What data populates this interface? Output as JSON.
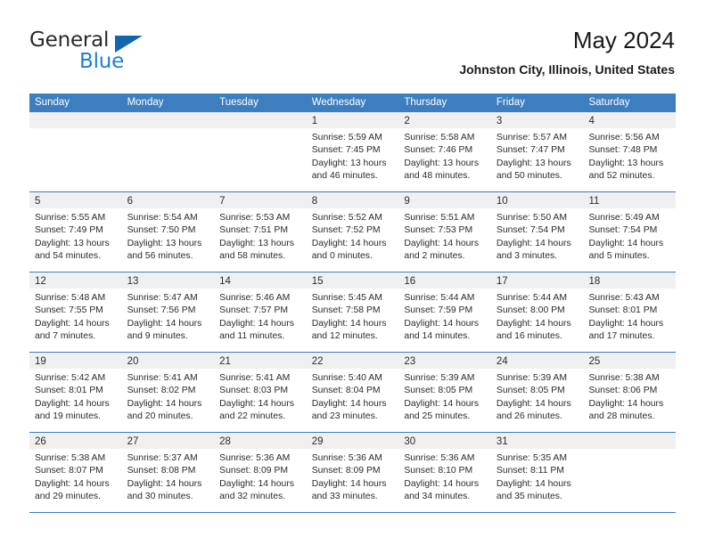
{
  "brand": {
    "name_top": "General",
    "name_bottom": "Blue",
    "flag_icon": "triangle-flag-icon",
    "color_top": "#2a2a2a",
    "color_bottom": "#1c7fd0",
    "flag_color": "#1266ad"
  },
  "header": {
    "title": "May 2024",
    "location": "Johnston City, Illinois, United States"
  },
  "theme": {
    "header_bg": "#3c7ebf",
    "header_text": "#ffffff",
    "day_band_bg": "#f0f0f0",
    "row_border": "#3c7ebf",
    "body_text": "#2b2b2b"
  },
  "weekdays": [
    "Sunday",
    "Monday",
    "Tuesday",
    "Wednesday",
    "Thursday",
    "Friday",
    "Saturday"
  ],
  "labels": {
    "sunrise_prefix": "Sunrise:",
    "sunset_prefix": "Sunset:",
    "daylight_prefix": "Daylight:"
  },
  "weeks": [
    [
      {
        "day": "",
        "empty": true,
        "lines": []
      },
      {
        "day": "",
        "empty": true,
        "lines": []
      },
      {
        "day": "",
        "empty": true,
        "lines": []
      },
      {
        "day": "1",
        "empty": false,
        "lines": [
          "Sunrise: 5:59 AM",
          "Sunset: 7:45 PM",
          "Daylight: 13 hours and 46 minutes."
        ]
      },
      {
        "day": "2",
        "empty": false,
        "lines": [
          "Sunrise: 5:58 AM",
          "Sunset: 7:46 PM",
          "Daylight: 13 hours and 48 minutes."
        ]
      },
      {
        "day": "3",
        "empty": false,
        "lines": [
          "Sunrise: 5:57 AM",
          "Sunset: 7:47 PM",
          "Daylight: 13 hours and 50 minutes."
        ]
      },
      {
        "day": "4",
        "empty": false,
        "lines": [
          "Sunrise: 5:56 AM",
          "Sunset: 7:48 PM",
          "Daylight: 13 hours and 52 minutes."
        ]
      }
    ],
    [
      {
        "day": "5",
        "empty": false,
        "lines": [
          "Sunrise: 5:55 AM",
          "Sunset: 7:49 PM",
          "Daylight: 13 hours and 54 minutes."
        ]
      },
      {
        "day": "6",
        "empty": false,
        "lines": [
          "Sunrise: 5:54 AM",
          "Sunset: 7:50 PM",
          "Daylight: 13 hours and 56 minutes."
        ]
      },
      {
        "day": "7",
        "empty": false,
        "lines": [
          "Sunrise: 5:53 AM",
          "Sunset: 7:51 PM",
          "Daylight: 13 hours and 58 minutes."
        ]
      },
      {
        "day": "8",
        "empty": false,
        "lines": [
          "Sunrise: 5:52 AM",
          "Sunset: 7:52 PM",
          "Daylight: 14 hours and 0 minutes."
        ]
      },
      {
        "day": "9",
        "empty": false,
        "lines": [
          "Sunrise: 5:51 AM",
          "Sunset: 7:53 PM",
          "Daylight: 14 hours and 2 minutes."
        ]
      },
      {
        "day": "10",
        "empty": false,
        "lines": [
          "Sunrise: 5:50 AM",
          "Sunset: 7:54 PM",
          "Daylight: 14 hours and 3 minutes."
        ]
      },
      {
        "day": "11",
        "empty": false,
        "lines": [
          "Sunrise: 5:49 AM",
          "Sunset: 7:54 PM",
          "Daylight: 14 hours and 5 minutes."
        ]
      }
    ],
    [
      {
        "day": "12",
        "empty": false,
        "lines": [
          "Sunrise: 5:48 AM",
          "Sunset: 7:55 PM",
          "Daylight: 14 hours and 7 minutes."
        ]
      },
      {
        "day": "13",
        "empty": false,
        "lines": [
          "Sunrise: 5:47 AM",
          "Sunset: 7:56 PM",
          "Daylight: 14 hours and 9 minutes."
        ]
      },
      {
        "day": "14",
        "empty": false,
        "lines": [
          "Sunrise: 5:46 AM",
          "Sunset: 7:57 PM",
          "Daylight: 14 hours and 11 minutes."
        ]
      },
      {
        "day": "15",
        "empty": false,
        "lines": [
          "Sunrise: 5:45 AM",
          "Sunset: 7:58 PM",
          "Daylight: 14 hours and 12 minutes."
        ]
      },
      {
        "day": "16",
        "empty": false,
        "lines": [
          "Sunrise: 5:44 AM",
          "Sunset: 7:59 PM",
          "Daylight: 14 hours and 14 minutes."
        ]
      },
      {
        "day": "17",
        "empty": false,
        "lines": [
          "Sunrise: 5:44 AM",
          "Sunset: 8:00 PM",
          "Daylight: 14 hours and 16 minutes."
        ]
      },
      {
        "day": "18",
        "empty": false,
        "lines": [
          "Sunrise: 5:43 AM",
          "Sunset: 8:01 PM",
          "Daylight: 14 hours and 17 minutes."
        ]
      }
    ],
    [
      {
        "day": "19",
        "empty": false,
        "lines": [
          "Sunrise: 5:42 AM",
          "Sunset: 8:01 PM",
          "Daylight: 14 hours and 19 minutes."
        ]
      },
      {
        "day": "20",
        "empty": false,
        "lines": [
          "Sunrise: 5:41 AM",
          "Sunset: 8:02 PM",
          "Daylight: 14 hours and 20 minutes."
        ]
      },
      {
        "day": "21",
        "empty": false,
        "lines": [
          "Sunrise: 5:41 AM",
          "Sunset: 8:03 PM",
          "Daylight: 14 hours and 22 minutes."
        ]
      },
      {
        "day": "22",
        "empty": false,
        "lines": [
          "Sunrise: 5:40 AM",
          "Sunset: 8:04 PM",
          "Daylight: 14 hours and 23 minutes."
        ]
      },
      {
        "day": "23",
        "empty": false,
        "lines": [
          "Sunrise: 5:39 AM",
          "Sunset: 8:05 PM",
          "Daylight: 14 hours and 25 minutes."
        ]
      },
      {
        "day": "24",
        "empty": false,
        "lines": [
          "Sunrise: 5:39 AM",
          "Sunset: 8:05 PM",
          "Daylight: 14 hours and 26 minutes."
        ]
      },
      {
        "day": "25",
        "empty": false,
        "lines": [
          "Sunrise: 5:38 AM",
          "Sunset: 8:06 PM",
          "Daylight: 14 hours and 28 minutes."
        ]
      }
    ],
    [
      {
        "day": "26",
        "empty": false,
        "lines": [
          "Sunrise: 5:38 AM",
          "Sunset: 8:07 PM",
          "Daylight: 14 hours and 29 minutes."
        ]
      },
      {
        "day": "27",
        "empty": false,
        "lines": [
          "Sunrise: 5:37 AM",
          "Sunset: 8:08 PM",
          "Daylight: 14 hours and 30 minutes."
        ]
      },
      {
        "day": "28",
        "empty": false,
        "lines": [
          "Sunrise: 5:36 AM",
          "Sunset: 8:09 PM",
          "Daylight: 14 hours and 32 minutes."
        ]
      },
      {
        "day": "29",
        "empty": false,
        "lines": [
          "Sunrise: 5:36 AM",
          "Sunset: 8:09 PM",
          "Daylight: 14 hours and 33 minutes."
        ]
      },
      {
        "day": "30",
        "empty": false,
        "lines": [
          "Sunrise: 5:36 AM",
          "Sunset: 8:10 PM",
          "Daylight: 14 hours and 34 minutes."
        ]
      },
      {
        "day": "31",
        "empty": false,
        "lines": [
          "Sunrise: 5:35 AM",
          "Sunset: 8:11 PM",
          "Daylight: 14 hours and 35 minutes."
        ]
      },
      {
        "day": "",
        "empty": true,
        "lines": []
      }
    ]
  ]
}
